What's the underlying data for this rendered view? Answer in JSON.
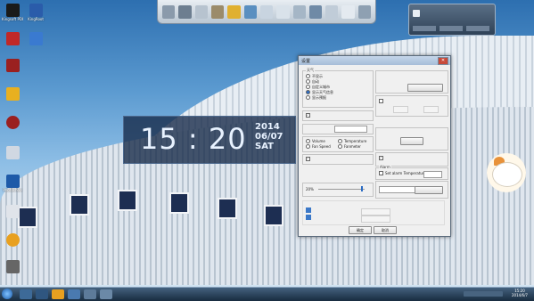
{
  "desktop_icons": [
    {
      "label": "Kingsoft PDF",
      "color": "#1a1a1a"
    },
    {
      "label": "KingRoot",
      "color": "#2a5caa"
    },
    {
      "label": "",
      "color": "#c02828"
    },
    {
      "label": "",
      "color": "#e8b020"
    },
    {
      "label": "",
      "color": "#9a2020"
    },
    {
      "label": "",
      "color": "#d0d8e2"
    },
    {
      "label": "Photoshop",
      "color": "#1e5aa8"
    },
    {
      "label": "",
      "color": "#e0e4ea"
    },
    {
      "label": "",
      "color": "#e8a020"
    },
    {
      "label": "",
      "color": "#666666"
    }
  ],
  "dock_icon_count": 13,
  "notify": {
    "line1": "",
    "line2": "",
    "btn1": "",
    "btn2": "",
    "btn3": ""
  },
  "clock": {
    "time": "15 : 20",
    "year": "2014",
    "date": "06/07",
    "weekday": "SAT"
  },
  "dialog": {
    "title": "设置",
    "group1_title": "天气",
    "radio1": "不显示",
    "radio2": "自动",
    "radio3": "自定义城市",
    "radio4": "显示天气信息",
    "radio5": "显示预报",
    "group2_title": "",
    "chk_a": "",
    "group3_title": "",
    "select_a": "",
    "group4_title": "",
    "opt1": "Volume",
    "opt2": "Temperature",
    "opt3": "Fan Speed",
    "opt4": "Fanmeter",
    "group5_title": "",
    "chk_b": "",
    "group6_title": "",
    "slider_val": "20%",
    "right_group1_title": "",
    "r_label1": "",
    "r_label2": "",
    "r_btn1": "",
    "right_group2_title": "",
    "r_chk1": "",
    "right_group3_title": "Alarm",
    "alarm_chk": "Set alarm Temperature",
    "right_group4_title": "",
    "r_select": "",
    "r_btn_apply": "",
    "right_group5_title": "",
    "r_btn2": "",
    "ok_label": "确定",
    "cancel_label": "取消"
  },
  "taskbar": {
    "clock_time": "15:20",
    "clock_date": "2014/6/7"
  },
  "accent": "#2b6cc4"
}
